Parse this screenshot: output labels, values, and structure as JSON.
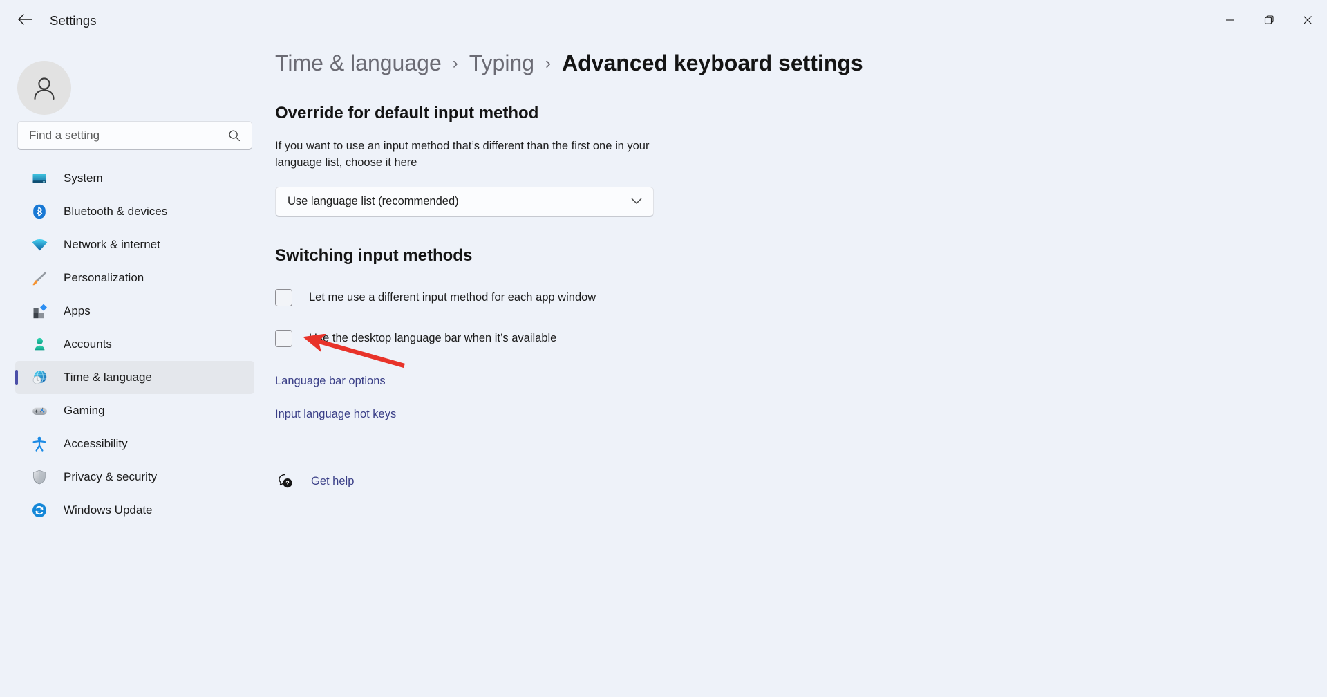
{
  "window": {
    "title": "Settings",
    "back_icon": "back-arrow-icon",
    "minimize_icon": "minimize-icon",
    "maximize_icon": "maximize-icon",
    "close_icon": "close-icon"
  },
  "sidebar": {
    "avatar_icon": "user-avatar-icon",
    "search": {
      "placeholder": "Find a setting",
      "value": "",
      "icon": "search-icon"
    },
    "items": [
      {
        "label": "System",
        "icon": "system-monitor-icon",
        "active": false
      },
      {
        "label": "Bluetooth & devices",
        "icon": "bluetooth-icon",
        "active": false
      },
      {
        "label": "Network & internet",
        "icon": "wifi-icon",
        "active": false
      },
      {
        "label": "Personalization",
        "icon": "paintbrush-icon",
        "active": false
      },
      {
        "label": "Apps",
        "icon": "apps-grid-icon",
        "active": false
      },
      {
        "label": "Accounts",
        "icon": "person-icon",
        "active": false
      },
      {
        "label": "Time & language",
        "icon": "globe-clock-icon",
        "active": true
      },
      {
        "label": "Gaming",
        "icon": "gamepad-icon",
        "active": false
      },
      {
        "label": "Accessibility",
        "icon": "accessibility-person-icon",
        "active": false
      },
      {
        "label": "Privacy & security",
        "icon": "shield-icon",
        "active": false
      },
      {
        "label": "Windows Update",
        "icon": "update-refresh-icon",
        "active": false
      }
    ]
  },
  "breadcrumb": {
    "crumb1": "Time & language",
    "sep1": "›",
    "crumb2": "Typing",
    "sep2": "›",
    "current": "Advanced keyboard settings"
  },
  "main": {
    "override_section": {
      "title": "Override for default input method",
      "description": "If you want to use an input method that’s different than the first one in your language list, choose it here",
      "dropdown": {
        "selected": "Use language list (recommended)",
        "chevron_icon": "chevron-down-icon"
      }
    },
    "switching_section": {
      "title": "Switching input methods",
      "checkbox1": {
        "label": "Let me use a different input method for each app window",
        "checked": false
      },
      "checkbox2": {
        "label": "Use the desktop language bar when it’s available",
        "checked": false
      },
      "link1": "Language bar options",
      "link2": "Input language hot keys"
    },
    "get_help": {
      "label": "Get help",
      "icon": "help-question-icon"
    }
  },
  "annotation": {
    "arrow_color": "#e8332a",
    "points_to": "Use the desktop language bar when it’s available"
  },
  "colors": {
    "page_background": "#eef2f9",
    "accent_selected": "#4b4fa8",
    "link": "#3a3f87",
    "selected_row_background": "#e4e7ec"
  }
}
